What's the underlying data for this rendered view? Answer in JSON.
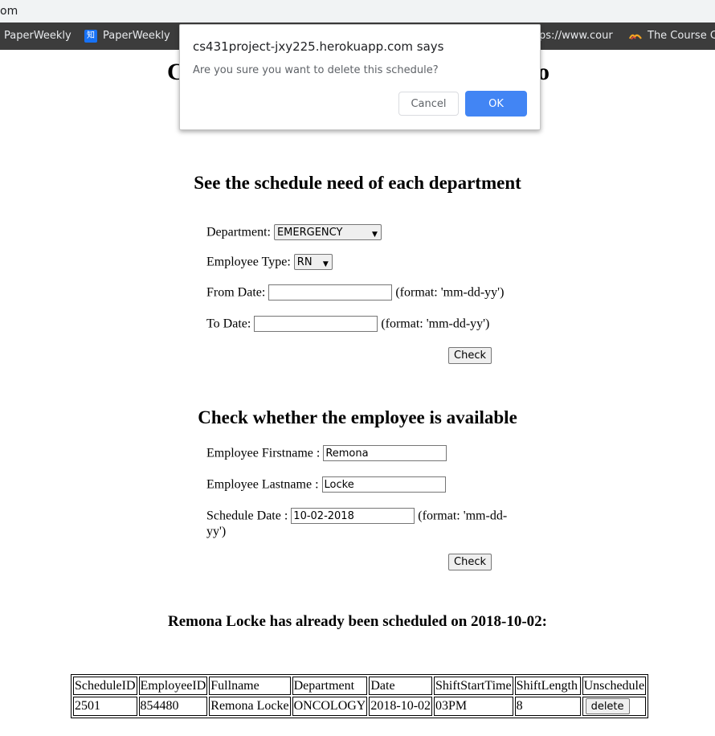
{
  "browser": {
    "url_fragment": "om",
    "bookmarks": [
      {
        "label": "PaperWeekly",
        "icon": "none"
      },
      {
        "label": "PaperWeekly",
        "icon": "zhihu-icon",
        "icon_text": "知"
      },
      {
        "label": "ps://www.cour",
        "icon": "none"
      },
      {
        "label": "The Course C",
        "icon": "course-logo-icon"
      }
    ]
  },
  "page": {
    "title_left": "C",
    "title_right": "o"
  },
  "schedule_need": {
    "heading": "See the schedule need of each department",
    "department_label": "Department:",
    "department_selected": "EMERGENCY",
    "employee_type_label": "Employee Type:",
    "employee_type_selected": "RN",
    "from_label": "From Date:",
    "from_value": "",
    "from_hint": "(format: 'mm-dd-yy')",
    "to_label": "To Date:",
    "to_value": "",
    "to_hint": "(format: 'mm-dd-yy')",
    "check_label": "Check"
  },
  "availability": {
    "heading": "Check whether the employee is available",
    "firstname_label": "Employee Firstname :",
    "firstname_value": "Remona",
    "lastname_label": "Employee Lastname :",
    "lastname_value": "Locke",
    "date_label": "Schedule Date :",
    "date_value": "10-02-2018",
    "date_hint_1": "(format: 'mm-dd-",
    "date_hint_2": "yy')",
    "check_label": "Check"
  },
  "result": {
    "heading": "Remona Locke has already been scheduled on 2018-10-02:",
    "columns": [
      "ScheduleID",
      "EmployeeID",
      "Fullname",
      "Department",
      "Date",
      "ShiftStartTime",
      "ShiftLength",
      "Unschedule"
    ],
    "rows": [
      [
        "2501",
        "854480",
        "Remona Locke",
        "ONCOLOGY",
        "2018-10-02",
        "03PM",
        "8"
      ]
    ],
    "delete_label": "delete"
  },
  "dialog": {
    "title": "cs431project-jxy225.herokuapp.com says",
    "message": "Are you sure you want to delete this schedule?",
    "cancel_label": "Cancel",
    "ok_label": "OK"
  },
  "colors": {
    "ok_button": "#4285f4",
    "bookmarks_bar": "#3c3c3c"
  }
}
